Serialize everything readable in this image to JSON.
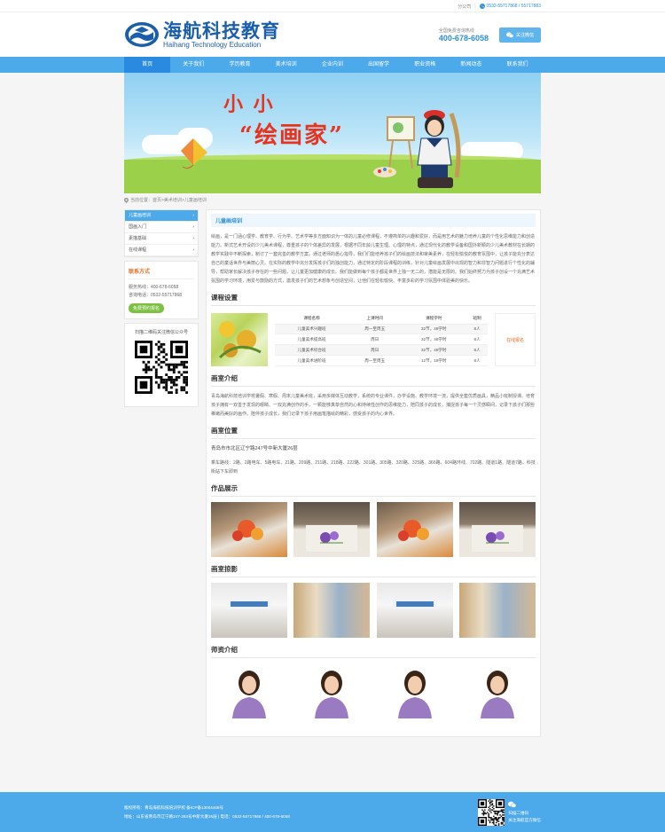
{
  "topbar": {
    "site_label": "分公司",
    "phones": "0532-55717868 / 55717883"
  },
  "header": {
    "logo_cn": "海航科技教育",
    "logo_en": "Haihang Technology Education",
    "hotline_label": "全国免费咨询热线",
    "hotline": "400-678-6058",
    "follow_button": "关注微信"
  },
  "nav": [
    "首页",
    "关于我们",
    "学历教育",
    "美术培训",
    "企业内训",
    "出国留学",
    "职业资格",
    "新闻动态",
    "联系我们"
  ],
  "banner": {
    "title_line1": "小 小",
    "title_line2": "“绘画家”"
  },
  "breadcrumb": "当前位置：首页>美术培训>儿童画培训",
  "sidebar": {
    "menu": [
      "儿童画培训",
      "国画入门",
      "素描基础",
      "在线课程"
    ],
    "contact_title": "联系方式",
    "contact_lines": [
      "服务热线：400-678-6058",
      "咨询电话：0532-55717868"
    ],
    "contact_button": "免费预约报名",
    "qr_title": "扫描二维码关注微信公众号"
  },
  "content": {
    "page_title": "儿童画培训",
    "intro": "绘画，是一门涵心理学、教育学、行为学、艺术学等多方面知识为一体的儿童必修课程，不遵简单的兴趣和爱好，而是用艺术的魅力培养儿童的个性化思维能力和创造能力。新式艺术开设的少儿美术课程，尊重孩子的个体差异的发展，根据不同年龄儿童生理、心理的特点，通过现代化的教学设备和国外新颖的少儿美术教材在长期的教学实践中不断探索，制订了一套完善的教学方案。通过老师的悉心指导，我们们能培养孩子们的绘画技法和审美素养，在轻松愉悦的教育氛围中，让孩子能充分表达自己的童话世界与美丽心灵。在实际的教学中充分发挥孩子们的独创能力，通过特定的阶段课程的训练，针对儿童绘画发展中出现的智力和非智力问题进行个性化的辅导，帮助家长解决孩子存在的一些问题，让儿童更加健康的成长。我们能做到每个孩子都是世界上独一无二的，潜能是无限的。我们始终努力为孩子创设一个充满艺术氛围的学习环境，用爱与鼓励的方式，激发孩子们的艺术想象与创造空间，让他们在轻松愉快、丰富多彩的学习氛围中体验美的快乐。",
    "course_title": "课程设置",
    "course_headers": [
      "课程名称",
      "上课时间",
      "课程学时",
      "班制"
    ],
    "course_rows": [
      [
        "儿童美术兴趣班",
        "周一至周五",
        "32节，48学时",
        "8人"
      ],
      [
        "儿童美术提高班",
        "周日",
        "32节，48学时",
        "8人"
      ],
      [
        "儿童美术综合班",
        "周日",
        "32节，48学时",
        "8人"
      ],
      [
        "儿童美术进阶班",
        "周一至周五",
        "12节，18学时",
        "8人"
      ]
    ],
    "course_cta": "在线报名",
    "studio_title": "画室介绍",
    "studio_text": "青岛海航科技培训学校暑假、寒假、周末儿童美术班，采用多媒体互动教学，系统的专业课件，办学设施、教学环境一流，提供全套优质画具，精品小班制授课。培育孩子拥有一双善于发现的眼睛、一双充满创作的手，一颗能够真挚自然的心和持续性创作的思维能力，陪同孩子的成长，捕捉孩子每一个灵感瞬间，记录下孩子们那些稚嫩而美好的画作。陪伴孩子成长，我们记录下孩子用画笔描绘的精彩，感受孩子的内心世界。",
    "location_title": "画室位置",
    "address": "青岛市市北区辽宁路247号中新大厦26层",
    "bus_lines": "乘车路线：2路、2路电车、5路电车、21路、209路、211路、218路、222路、301路、305路、320路、325路、366路、604路环线、702路、隧道1路、隧道7路，科技街站下车即到",
    "works_title": "作品展示",
    "photos_title": "画室掠影",
    "teachers_title": "师资介绍"
  },
  "footer": {
    "line1": "版权所有：青岛海航科技培训学校  备ICP备13004468号",
    "line2": "地址：山东省青岛市辽宁路247-263号中新大厦26层 | 电话：0532-55717868 / 400-678-6058",
    "wechat1": "扫描二维码",
    "wechat2": "关注海航官方微信"
  },
  "colors": {
    "primary": "#4ca9ea",
    "accent": "#e86b20",
    "brand": "#1b5eab"
  }
}
